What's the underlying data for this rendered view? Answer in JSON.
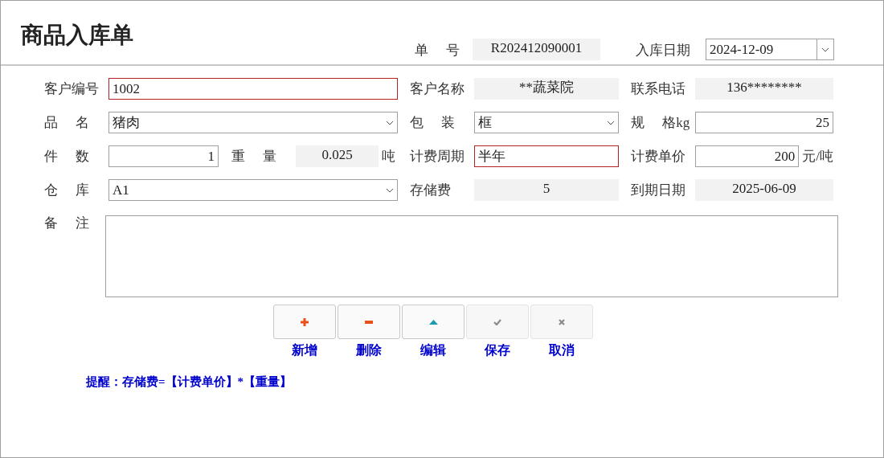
{
  "title": "商品入库单",
  "order_no": {
    "label": "单 号",
    "value": "R202412090001"
  },
  "inbound_date": {
    "label": "入库日期",
    "value": "2024-12-09"
  },
  "rows": [
    {
      "cells": [
        [
          {
            "kind": "text",
            "label": "客户编号",
            "value": "1002",
            "invalid": true
          }
        ],
        [
          {
            "kind": "readonly",
            "label": "客户名称",
            "value": "**蔬菜院"
          }
        ],
        [
          {
            "kind": "readonly",
            "label": "联系电话",
            "value": "136********"
          }
        ]
      ]
    },
    {
      "cells": [
        [
          {
            "kind": "select",
            "label": "品 名",
            "value": "猪肉"
          }
        ],
        [
          {
            "kind": "select",
            "label": "包 装",
            "value": "框"
          }
        ],
        [
          {
            "kind": "number",
            "label": "规 格kg",
            "value": "25"
          }
        ]
      ]
    },
    {
      "cells": [
        [
          {
            "kind": "number",
            "label": "件 数",
            "value": "1"
          },
          {
            "kind": "readonly",
            "label": "重 量",
            "value": "0.025",
            "unit": "吨"
          }
        ],
        [
          {
            "kind": "text",
            "label": "计费周期",
            "value": "半年",
            "invalid": true
          }
        ],
        [
          {
            "kind": "number",
            "label": "计费单价",
            "value": "200",
            "unit": "元/吨"
          }
        ]
      ]
    },
    {
      "cells": [
        [
          {
            "kind": "select",
            "label": "仓 库",
            "value": "A1"
          }
        ],
        [
          {
            "kind": "readonly",
            "label": "存储费",
            "value": "5"
          }
        ],
        [
          {
            "kind": "readonly",
            "label": "到期日期",
            "value": "2025-06-09"
          }
        ]
      ]
    }
  ],
  "remarks": {
    "label": "备 注"
  },
  "buttons": [
    {
      "kind": "add",
      "label": "新增",
      "disabled": false
    },
    {
      "kind": "delete",
      "label": "删除",
      "disabled": false
    },
    {
      "kind": "edit",
      "label": "编辑",
      "disabled": false
    },
    {
      "kind": "save",
      "label": "保存",
      "disabled": true
    },
    {
      "kind": "cancel",
      "label": "取消",
      "disabled": true
    }
  ],
  "note": "提醒：存储费=【计费单价】*【重量】"
}
